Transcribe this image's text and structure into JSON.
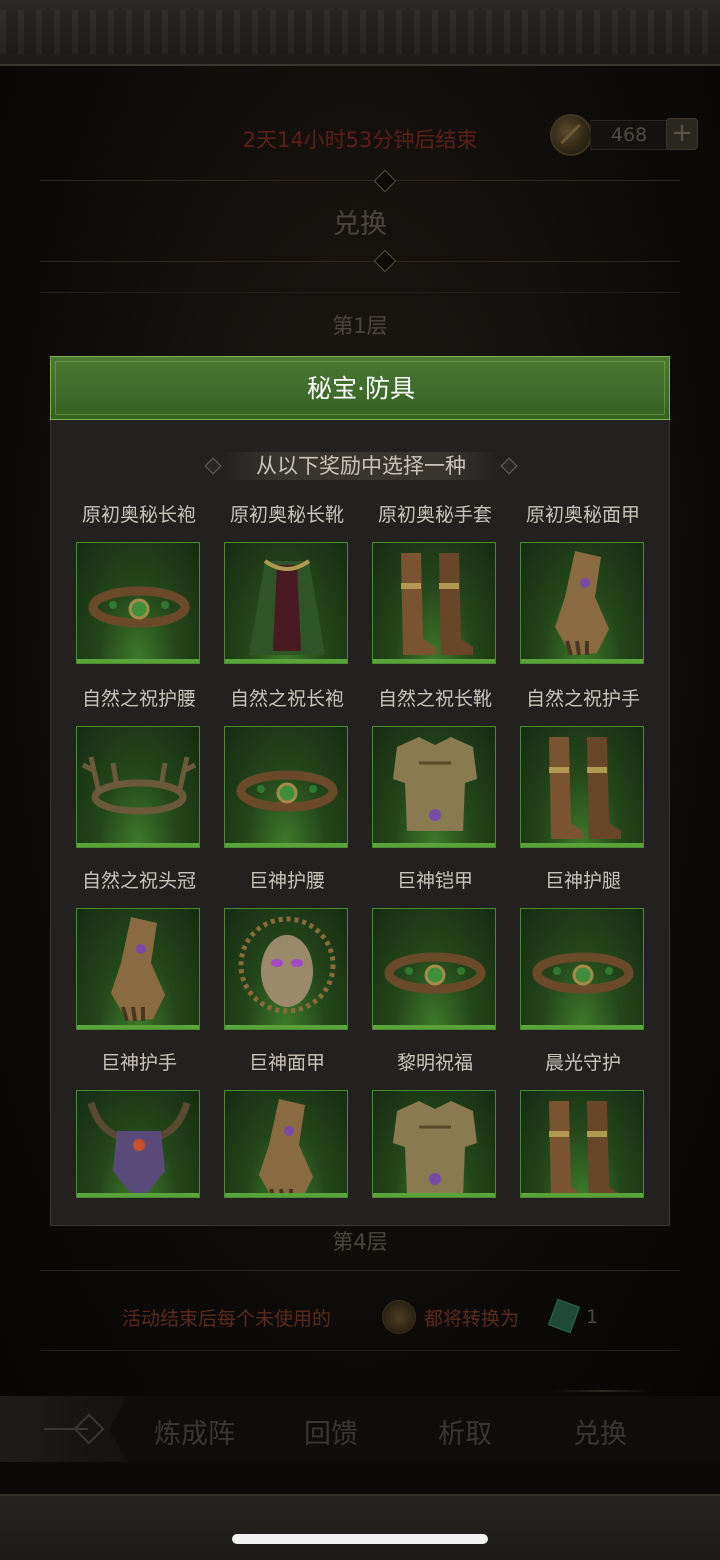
{
  "header": {
    "timer": "2天14小时53分钟后结束",
    "currency_amount": "468",
    "add_label": "+"
  },
  "section": {
    "title": "兑换",
    "layer_1": "第1层",
    "layer_4": "第4层"
  },
  "dialog": {
    "title": "秘宝·防具",
    "subtitle": "从以下奖励中选择一种",
    "items": [
      {
        "name": "原初奥秘长袍",
        "icon": "belt-icon"
      },
      {
        "name": "原初奥秘长靴",
        "icon": "cloak-icon"
      },
      {
        "name": "原初奥秘手套",
        "icon": "boots-icon"
      },
      {
        "name": "原初奥秘面甲",
        "icon": "gauntlet-icon"
      },
      {
        "name": "自然之祝护腰",
        "icon": "antler-crown-icon"
      },
      {
        "name": "自然之祝长袍",
        "icon": "belt-icon"
      },
      {
        "name": "自然之祝长靴",
        "icon": "chest-armor-icon"
      },
      {
        "name": "自然之祝护手",
        "icon": "boots-icon"
      },
      {
        "name": "自然之祝头冠",
        "icon": "gauntlet-icon"
      },
      {
        "name": "巨神护腰",
        "icon": "mask-icon"
      },
      {
        "name": "巨神铠甲",
        "icon": "belt-icon"
      },
      {
        "name": "巨神护腿",
        "icon": "belt-icon"
      },
      {
        "name": "巨神护手",
        "icon": "horned-helmet-icon"
      },
      {
        "name": "巨神面甲",
        "icon": "gauntlet-icon"
      },
      {
        "name": "黎明祝福",
        "icon": "chest-armor-icon"
      },
      {
        "name": "晨光守护",
        "icon": "boots-icon"
      }
    ]
  },
  "notice": {
    "text_before": "活动结束后每个未使用的",
    "text_after": "都将转换为",
    "count": "1"
  },
  "tabs": [
    {
      "label": "炼成阵"
    },
    {
      "label": "回馈"
    },
    {
      "label": "析取"
    },
    {
      "label": "兑换"
    }
  ]
}
